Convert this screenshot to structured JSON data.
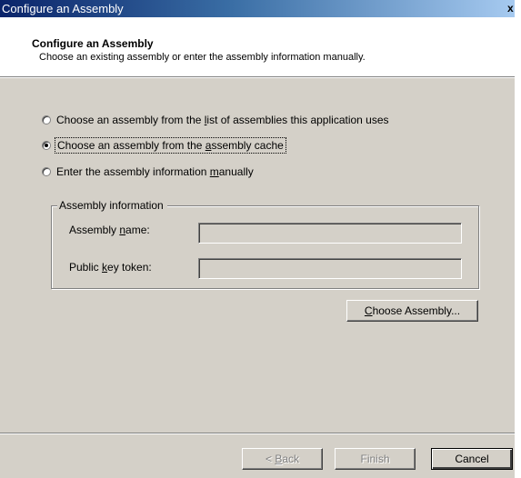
{
  "window": {
    "title": "Configure an Assembly",
    "close_glyph": "x"
  },
  "header": {
    "title": "Configure an Assembly",
    "subtitle": "Choose an existing assembly or enter the assembly information manually."
  },
  "options": [
    {
      "pre": "Choose an assembly from the ",
      "key": "l",
      "post": "ist of assemblies this application uses",
      "checked": false
    },
    {
      "pre": "Choose an assembly from the ",
      "key": "a",
      "post": "ssembly cache",
      "checked": true
    },
    {
      "pre": "Enter the assembly information ",
      "key": "m",
      "post": "anually",
      "checked": false
    }
  ],
  "group": {
    "title": "Assembly information",
    "name_label_pre": "Assembly ",
    "name_label_key": "n",
    "name_label_post": "ame:",
    "name_value": "",
    "token_label_pre": "Public ",
    "token_label_key": "k",
    "token_label_post": "ey token:",
    "token_value": ""
  },
  "buttons": {
    "choose_key": "C",
    "choose_rest": "hoose Assembly...",
    "back_prefix": "< ",
    "back_key": "B",
    "back_rest": "ack",
    "finish": "Finish",
    "cancel": "Cancel"
  }
}
